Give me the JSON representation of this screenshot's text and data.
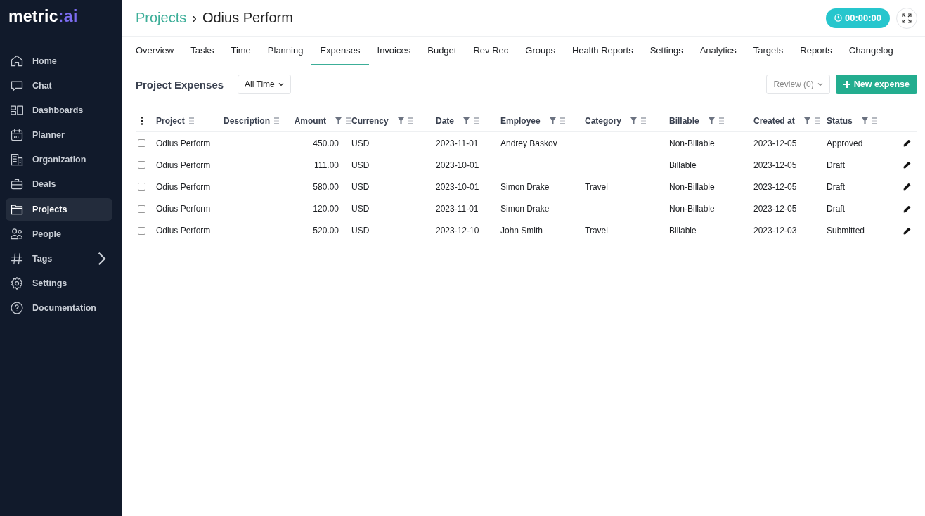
{
  "logo": {
    "text": "metric",
    "accent": ":ai"
  },
  "sidebar": {
    "items": [
      {
        "label": "Home",
        "selected": false,
        "has_submenu": false
      },
      {
        "label": "Chat",
        "selected": false,
        "has_submenu": false
      },
      {
        "label": "Dashboards",
        "selected": false,
        "has_submenu": false
      },
      {
        "label": "Planner",
        "selected": false,
        "has_submenu": false
      },
      {
        "label": "Organization",
        "selected": false,
        "has_submenu": false
      },
      {
        "label": "Deals",
        "selected": false,
        "has_submenu": false
      },
      {
        "label": "Projects",
        "selected": true,
        "has_submenu": false
      },
      {
        "label": "People",
        "selected": false,
        "has_submenu": false
      },
      {
        "label": "Tags",
        "selected": false,
        "has_submenu": true
      },
      {
        "label": "Settings",
        "selected": false,
        "has_submenu": false
      },
      {
        "label": "Documentation",
        "selected": false,
        "has_submenu": false
      }
    ]
  },
  "breadcrumb": {
    "parent": "Projects",
    "separator": "›",
    "current": "Odius Perform"
  },
  "timer": "00:00:00",
  "tabs": [
    {
      "label": "Overview",
      "selected": false
    },
    {
      "label": "Tasks",
      "selected": false
    },
    {
      "label": "Time",
      "selected": false
    },
    {
      "label": "Planning",
      "selected": false
    },
    {
      "label": "Expenses",
      "selected": true
    },
    {
      "label": "Invoices",
      "selected": false
    },
    {
      "label": "Budget",
      "selected": false
    },
    {
      "label": "Rev Rec",
      "selected": false
    },
    {
      "label": "Groups",
      "selected": false
    },
    {
      "label": "Health Reports",
      "selected": false
    },
    {
      "label": "Settings",
      "selected": false
    },
    {
      "label": "Analytics",
      "selected": false
    },
    {
      "label": "Targets",
      "selected": false
    },
    {
      "label": "Reports",
      "selected": false
    },
    {
      "label": "Changelog",
      "selected": false
    }
  ],
  "section": {
    "title": "Project Expenses",
    "period": "All Time",
    "review": "Review (0)",
    "new_button": "New expense"
  },
  "table": {
    "columns": [
      {
        "label": "Project",
        "filter": false,
        "kind": "text"
      },
      {
        "label": "Description",
        "filter": false,
        "kind": "text"
      },
      {
        "label": "Amount",
        "filter": true,
        "kind": "number"
      },
      {
        "label": "Currency",
        "filter": true,
        "kind": "text"
      },
      {
        "label": "Date",
        "filter": true,
        "kind": "text"
      },
      {
        "label": "Employee",
        "filter": true,
        "kind": "text"
      },
      {
        "label": "Category",
        "filter": true,
        "kind": "text"
      },
      {
        "label": "Billable",
        "filter": true,
        "kind": "text"
      },
      {
        "label": "Created at",
        "filter": true,
        "kind": "text"
      },
      {
        "label": "Status",
        "filter": true,
        "kind": "text"
      }
    ],
    "rows": [
      {
        "checked": false,
        "cells": [
          "Odius Perform",
          "",
          "450.00",
          "USD",
          "2023-11-01",
          "Andrey Baskov",
          "",
          "Non-Billable",
          "2023-12-05",
          "Approved"
        ]
      },
      {
        "checked": false,
        "cells": [
          "Odius Perform",
          "",
          "111.00",
          "USD",
          "2023-10-01",
          "",
          "",
          "Billable",
          "2023-12-05",
          "Draft"
        ]
      },
      {
        "checked": false,
        "cells": [
          "Odius Perform",
          "",
          "580.00",
          "USD",
          "2023-10-01",
          "Simon Drake",
          "Travel",
          "Non-Billable",
          "2023-12-05",
          "Draft"
        ]
      },
      {
        "checked": false,
        "cells": [
          "Odius Perform",
          "",
          "120.00",
          "USD",
          "2023-11-01",
          "Simon Drake",
          "",
          "Non-Billable",
          "2023-12-05",
          "Draft"
        ]
      },
      {
        "checked": false,
        "cells": [
          "Odius Perform",
          "",
          "520.00",
          "USD",
          "2023-12-10",
          "John Smith",
          "Travel",
          "Billable",
          "2023-12-03",
          "Submitted"
        ]
      }
    ]
  }
}
